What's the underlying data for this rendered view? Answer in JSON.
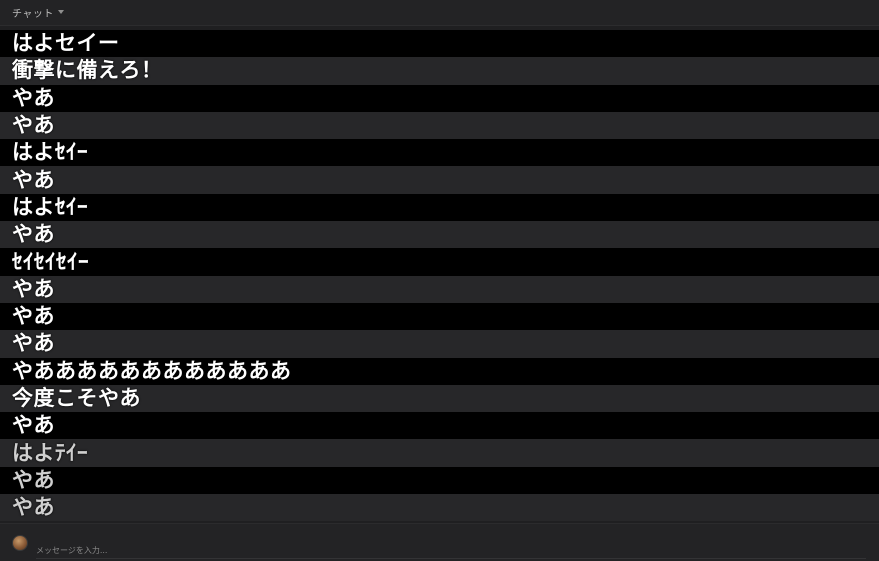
{
  "header": {
    "tab_label": "チャット"
  },
  "messages": [
    {
      "text": "はよセイー"
    },
    {
      "text": "衝撃に備えろ！"
    },
    {
      "text": "やあ"
    },
    {
      "text": "やあ"
    },
    {
      "text": "はよｾｲｰ"
    },
    {
      "text": "やあ"
    },
    {
      "text": "はよｾｲｰ"
    },
    {
      "text": "やあ"
    },
    {
      "text": "ｾｲｾｲｾｲｰ"
    },
    {
      "text": "やあ"
    },
    {
      "text": "やあ"
    },
    {
      "text": "やあ"
    },
    {
      "text": "やああああああああああああ"
    },
    {
      "text": "今度こそやあ"
    },
    {
      "text": "やあ"
    },
    {
      "text": "はよﾃｲｰ"
    },
    {
      "text": "やあ"
    },
    {
      "text": "やあ"
    }
  ],
  "footer": {
    "input_placeholder": "メッセージを入力...",
    "input_value": ""
  }
}
